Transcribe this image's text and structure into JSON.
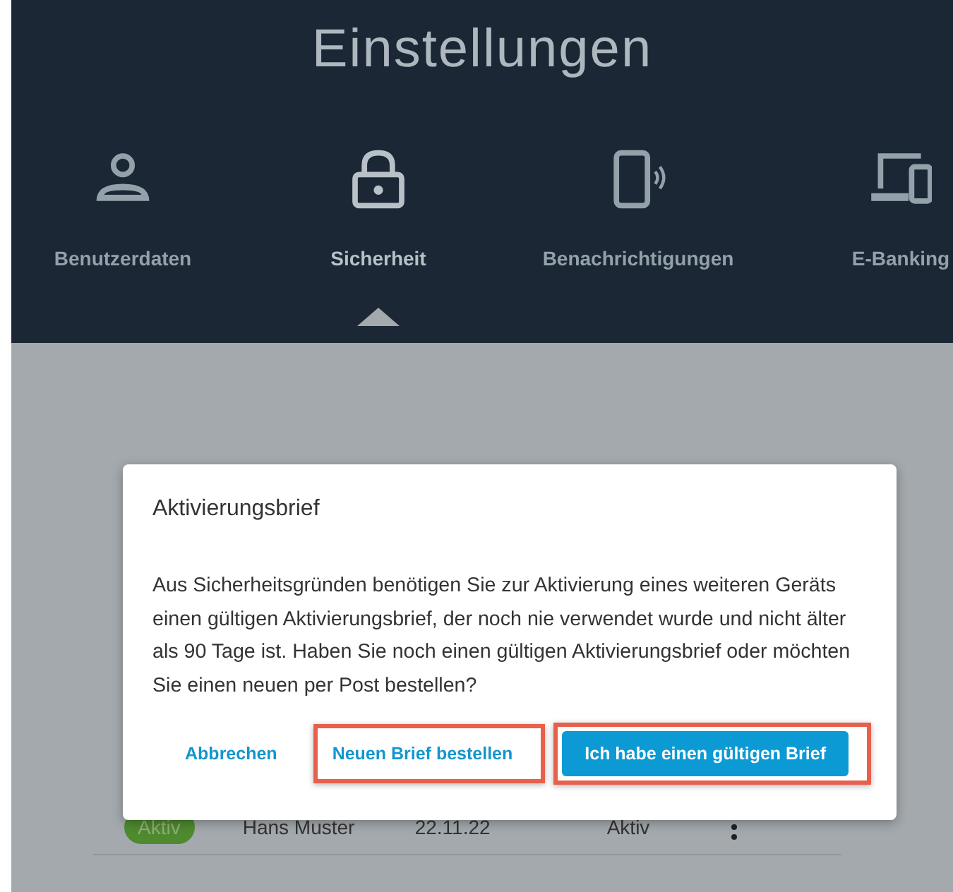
{
  "header": {
    "title": "Einstellungen"
  },
  "tabs": [
    {
      "label": "Benutzerdaten",
      "kind": "person",
      "selected": false
    },
    {
      "label": "Sicherheit",
      "kind": "lock",
      "selected": true
    },
    {
      "label": "Benachrichtigungen",
      "kind": "phone",
      "selected": false
    },
    {
      "label": "E-Banking",
      "kind": "devices",
      "selected": false
    }
  ],
  "devices": [
    {
      "badge": "Aktiv",
      "name": "Hans Muster",
      "date": "22.11.22",
      "status": "Aktiv"
    }
  ],
  "dialog": {
    "title": "Aktivierungsbrief",
    "body": "Aus Sicherheitsgründen benötigen Sie zur Aktivierung eines weiteren Geräts einen gültigen Aktivierungsbrief, der noch nie verwendet wurde und nicht älter als 90 Tage ist. Haben Sie noch einen gültigen Aktivierungsbrief oder möchten Sie einen neuen per Post bestellen?",
    "buttons": [
      {
        "label": "Abbrechen",
        "kind": "link",
        "highlighted": false
      },
      {
        "label": "Neuen Brief bestellen",
        "kind": "link",
        "highlighted": true
      },
      {
        "label": "Ich habe einen gültigen Brief",
        "kind": "primary",
        "highlighted": true
      }
    ]
  }
}
